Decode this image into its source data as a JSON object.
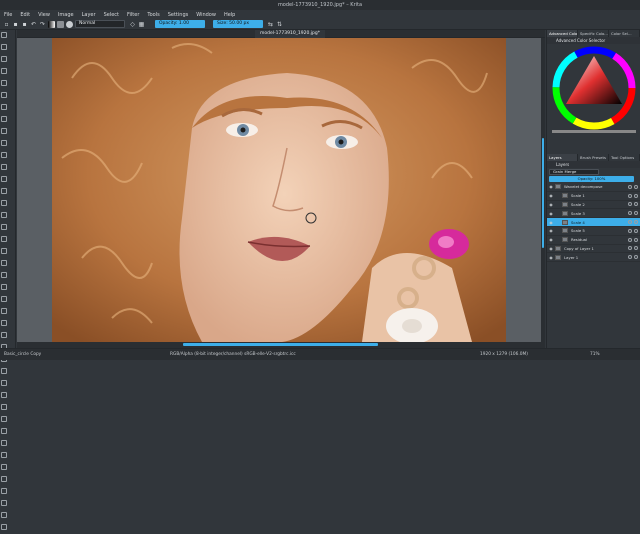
{
  "window_title": "model-1773910_1920.jpg* – Krita",
  "menu": [
    "File",
    "Edit",
    "View",
    "Image",
    "Layer",
    "Select",
    "Filter",
    "Tools",
    "Settings",
    "Window",
    "Help"
  ],
  "toolbar": {
    "blend_mode": "Normal",
    "opacity_label": "Opacity: 1.00",
    "size_label": "Size: 50.00 px"
  },
  "document_tab": "model-1773910_1920.jpg*",
  "right_panel": {
    "top_tabs": [
      "Advanced Colo...",
      "Specific Colo...",
      "Color Sel..."
    ],
    "color_selector_title": "Advanced Color Selector",
    "mid_tabs": [
      "Layers",
      "Brush Presets",
      "Tool Options"
    ],
    "layers_title": "Layers",
    "layers_blend": "Grain Merge",
    "layers_opacity": "Opacity: 100%",
    "layers": [
      {
        "name": "Wavelet decompose",
        "indent": 0,
        "selected": false
      },
      {
        "name": "Scale 1",
        "indent": 1,
        "selected": false
      },
      {
        "name": "Scale 2",
        "indent": 1,
        "selected": false
      },
      {
        "name": "Scale 3",
        "indent": 1,
        "selected": false
      },
      {
        "name": "Scale 4",
        "indent": 1,
        "selected": true
      },
      {
        "name": "Scale 5",
        "indent": 1,
        "selected": false
      },
      {
        "name": "Residual",
        "indent": 1,
        "selected": false
      },
      {
        "name": "Copy of Layer 1",
        "indent": 0,
        "selected": false
      },
      {
        "name": "Layer 1",
        "indent": 0,
        "selected": false
      }
    ]
  },
  "status": {
    "brush": "Basic_circle Copy",
    "color_info": "RGB/Alpha (8-bit integer/channel)  sRGB-elle-V2-srgbtrc.icc",
    "dims": "1920 x 1279 (106.0M)",
    "zoom": "71%"
  },
  "colors": {
    "accent": "#3daee9",
    "bg": "#31363b"
  }
}
